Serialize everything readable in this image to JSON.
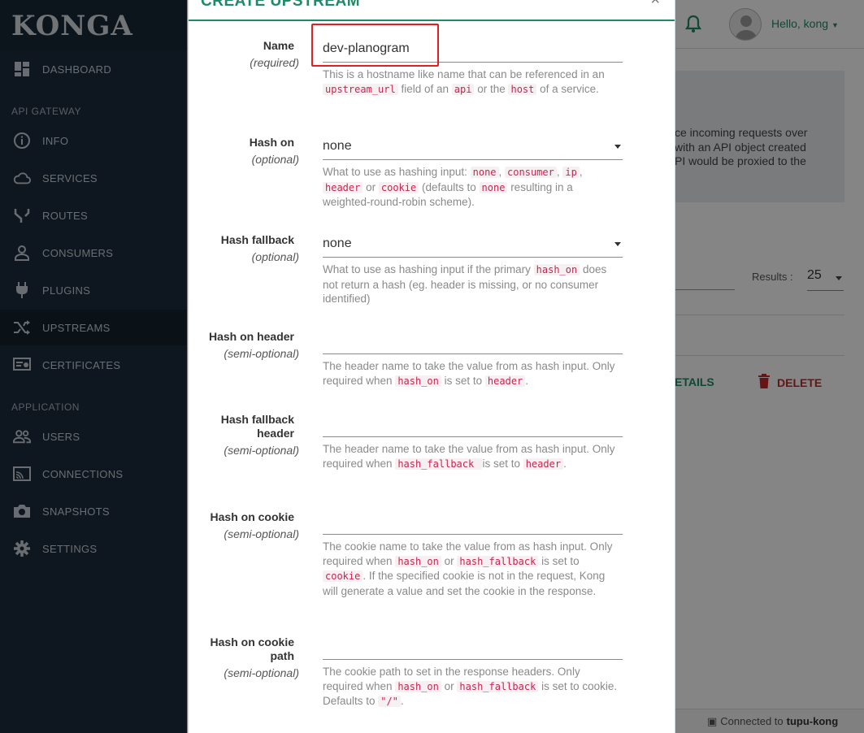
{
  "brand": {
    "logo": "KONGA"
  },
  "sidebar": {
    "sections": [
      {
        "title": "API GATEWAY"
      },
      {
        "title": "APPLICATION"
      }
    ],
    "items": [
      {
        "label": "DASHBOARD",
        "icon": "dashboard-icon"
      },
      {
        "label": "INFO",
        "icon": "info-icon"
      },
      {
        "label": "SERVICES",
        "icon": "cloud-icon"
      },
      {
        "label": "ROUTES",
        "icon": "routes-icon"
      },
      {
        "label": "CONSUMERS",
        "icon": "user-icon"
      },
      {
        "label": "PLUGINS",
        "icon": "plug-icon"
      },
      {
        "label": "UPSTREAMS",
        "icon": "shuffle-icon"
      },
      {
        "label": "CERTIFICATES",
        "icon": "certificate-icon"
      },
      {
        "label": "USERS",
        "icon": "users-icon"
      },
      {
        "label": "CONNECTIONS",
        "icon": "cast-icon"
      },
      {
        "label": "SNAPSHOTS",
        "icon": "camera-icon"
      },
      {
        "label": "SETTINGS",
        "icon": "gear-icon"
      }
    ]
  },
  "header": {
    "greeting": "Hello, kong"
  },
  "background": {
    "info_text": "ce incoming requests over\nwith an API object created\nPI would be proxied to the",
    "results_label": "Results :",
    "results_value": "25",
    "details_label": "ETAILS",
    "delete_label": "DELETE",
    "status_prefix": "Connected to",
    "status_name": "tupu-kong"
  },
  "modal": {
    "title": "CREATE UPSTREAM",
    "close": "×",
    "fields": {
      "name": {
        "label": "Name",
        "sub": "(required)",
        "value": "dev-planogram"
      },
      "hash_on": {
        "label": "Hash on",
        "sub": "(optional)",
        "value": "none"
      },
      "hash_fallback": {
        "label": "Hash fallback",
        "sub": "(optional)",
        "value": "none"
      },
      "hash_on_header": {
        "label": "Hash on header",
        "sub": "(semi-optional)",
        "value": ""
      },
      "hash_fallback_header": {
        "label1": "Hash fallback",
        "label2": "header",
        "sub": "(semi-optional)",
        "value": ""
      },
      "hash_on_cookie": {
        "label": "Hash on cookie",
        "sub": "(semi-optional)",
        "value": ""
      },
      "hash_on_cookie_path": {
        "label1": "Hash on cookie",
        "label2": "path",
        "sub": "(semi-optional)",
        "value": ""
      }
    },
    "help": {
      "name": [
        "This is a hostname like name that can be referenced in an ",
        "upstream_url",
        " field of an ",
        "api",
        " or the ",
        "host",
        " of a service."
      ],
      "hash_on": [
        "What to use as hashing input: ",
        "none",
        ", ",
        "consumer",
        ", ",
        "ip",
        ", ",
        "header",
        " or ",
        "cookie",
        " (defaults to ",
        "none",
        " resulting in a weighted-round-robin scheme)."
      ],
      "hash_fallback": [
        "What to use as hashing input if the primary ",
        "hash_on",
        " does not return a hash (eg. header is missing, or no consumer identified)"
      ],
      "hash_on_header": [
        "The header name to take the value from as hash input. Only required when ",
        "hash_on",
        " is set to ",
        "header",
        "."
      ],
      "hash_fallback_header": [
        "The header name to take the value from as hash input. Only required when ",
        "hash_fallback ",
        " is set to ",
        "header",
        "."
      ],
      "hash_on_cookie": [
        "The cookie name to take the value from as hash input. Only required when ",
        "hash_on",
        " or ",
        "hash_fallback",
        " is set to ",
        "cookie",
        ". If the specified cookie is not in the request, Kong will generate a value and set the cookie in the response."
      ],
      "hash_on_cookie_path": [
        "The cookie path to set in the response headers. Only required when ",
        "hash_on",
        " or ",
        "hash_fallback",
        " is set to cookie. Defaults to ",
        "\"/\"",
        "."
      ]
    }
  },
  "colors": {
    "accent": "#1e8a6a",
    "sidebar": "#1b2d3c",
    "code": "#c7254e",
    "highlight": "#e02020"
  }
}
